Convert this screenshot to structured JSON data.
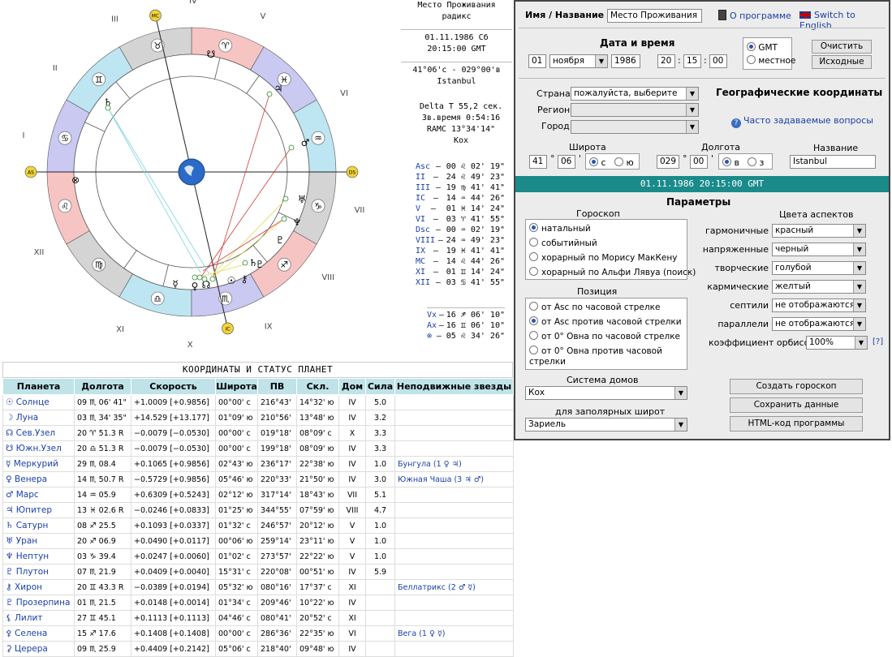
{
  "chart_header": {
    "title1": "Место Проживания",
    "title2": "радикс",
    "date": "01.11.1986 Сб",
    "time": "20:15:00 GMT",
    "coords": "41°06'c - 029°00'в",
    "city": "Istanbul"
  },
  "delta": {
    "deltat": "Delta T  55,2 сек.",
    "sidereal": "Зв.время 0:54:16",
    "ramc": "RAMC 13°34'14\"",
    "system": "Кох"
  },
  "cusps": [
    {
      "label": "Asc",
      "value": "00 ♌ 02' 19\""
    },
    {
      "label": "II",
      "value": "24 ♌ 49' 23\""
    },
    {
      "label": "III",
      "value": "19 ♍ 41' 41\""
    },
    {
      "label": "IC",
      "value": "14 ♒ 44' 26\""
    },
    {
      "label": "V",
      "value": "01 ♓ 14' 24\""
    },
    {
      "label": "VI",
      "value": "03 ♈ 41' 55\""
    },
    {
      "label": "Dsc",
      "value": "00 ♒ 02' 19\""
    },
    {
      "label": "VIII",
      "value": "24 ♒ 49' 23\""
    },
    {
      "label": "IX",
      "value": "19 ♓ 41' 41\""
    },
    {
      "label": "MC",
      "value": "14 ♌ 44' 26\""
    },
    {
      "label": "XI",
      "value": "01 ♊ 14' 24\""
    },
    {
      "label": "XII",
      "value": "03 ♋ 41' 55\""
    }
  ],
  "extra_points": [
    {
      "label": "Vx",
      "value": "16 ♐ 06' 10\""
    },
    {
      "label": "Ax",
      "value": "16 ♊ 06' 10\""
    },
    {
      "label": "⊗",
      "value": "05 ♌ 34' 26\""
    }
  ],
  "wheel": {
    "house_numerals": [
      "I",
      "II",
      "III",
      "IV",
      "V",
      "VI",
      "VII",
      "VIII",
      "IX",
      "X",
      "XI",
      "XII"
    ],
    "axis_labels": {
      "asc": "AS",
      "dsc": "DS",
      "mc": "MC",
      "ic": "IC"
    }
  },
  "planets_table": {
    "title": "КООРДИНАТЫ И СТАТУС ПЛАНЕТ",
    "headers": [
      "Планета",
      "Долгота",
      "Скорость",
      "Широта",
      "ПВ",
      "Скл.",
      "Дом",
      "Сила",
      "Неподвижные звезды"
    ],
    "rows": [
      [
        "☉ Солнце",
        "09 ♏ 06' 41\"",
        "+1.0009  [+0.9856]",
        "00°00' с",
        "216°43'",
        "14°32' ю",
        "IV",
        "5.0",
        ""
      ],
      [
        "☽ Луна",
        "03 ♏ 34' 35\"",
        "+14.529  [+13.177]",
        "01°09' ю",
        "210°56'",
        "13°48' ю",
        "IV",
        "3.2",
        ""
      ],
      [
        "☊ Сев.Узел",
        "20 ♈ 51.3  R",
        "−0.0079  [−0.0530]",
        "00°00' с",
        "019°18'",
        "08°09' с",
        "X",
        "3.3",
        ""
      ],
      [
        "☋ Южн.Узел",
        "20 ♎ 51.3  R",
        "−0.0079  [−0.0530]",
        "00°00' с",
        "199°18'",
        "08°09' ю",
        "IV",
        "3.3",
        ""
      ],
      [
        "☿ Меркурий",
        "29 ♏ 08.4",
        "+0.1065  [+0.9856]",
        "02°43' ю",
        "236°17'",
        "22°38' ю",
        "IV",
        "1.0",
        "Бунгула (1 ♀ ♃)"
      ],
      [
        "♀ Венера",
        "14 ♏ 50.7  R",
        "−0.5729  [+0.9856]",
        "05°46' ю",
        "220°33'",
        "21°50' ю",
        "IV",
        "3.0",
        "Южная Чаша (3 ♃ ♂)"
      ],
      [
        "♂ Марс",
        "14 ♒ 05.9",
        "+0.6309  [+0.5243]",
        "02°12' ю",
        "317°14'",
        "18°43' ю",
        "VII",
        "5.1",
        ""
      ],
      [
        "♃ Юпитер",
        "13 ♓ 02.6  R",
        "−0.0246  [+0.0833]",
        "01°25' ю",
        "344°55'",
        "07°59' ю",
        "VIII",
        "4.7",
        ""
      ],
      [
        "♄ Сатурн",
        "08 ♐ 25.5",
        "+0.1093  [+0.0337]",
        "01°32' с",
        "246°57'",
        "20°12' ю",
        "V",
        "1.0",
        ""
      ],
      [
        "♅ Уран",
        "20 ♐ 06.9",
        "+0.0490  [+0.0117]",
        "00°06' ю",
        "259°14'",
        "23°11' ю",
        "V",
        "1.0",
        ""
      ],
      [
        "♆ Нептун",
        "03 ♑ 39.4",
        "+0.0247  [+0.0060]",
        "01°02' с",
        "273°57'",
        "22°22' ю",
        "V",
        "1.0",
        ""
      ],
      [
        "♇ Плутон",
        "07 ♏ 21.9",
        "+0.0409  [+0.0040]",
        "15°31' с",
        "220°08'",
        "00°51' ю",
        "IV",
        "5.9",
        ""
      ],
      [
        "⚷ Хирон",
        "20 ♊ 43.3  R",
        "−0.0389  [+0.0194]",
        "05°32' ю",
        "080°16'",
        "17°37' с",
        "XI",
        "",
        "Беллатрикс (2 ♂ ☿)"
      ],
      [
        "♇ Прозерпина",
        "01 ♏ 21.5",
        "+0.0148  [+0.0014]",
        "01°34' с",
        "209°46'",
        "10°22' ю",
        "IV",
        "",
        ""
      ],
      [
        "⚸ Лилит",
        "27 ♊ 45.1",
        "+0.1113  [+0.1113]",
        "04°46' с",
        "080°41'",
        "20°52' с",
        "XI",
        "",
        ""
      ],
      [
        "⚴ Селена",
        "15 ♐ 17.6",
        "+0.1408  [+0.1408]",
        "00°00' с",
        "286°36'",
        "22°35' ю",
        "VI",
        "",
        "Вега (1 ♀ ☿)"
      ],
      [
        "⚳ Церера",
        "09 ♏ 25.9",
        "+0.4409  [+0.2142]",
        "05°06' с",
        "218°40'",
        "09°48' ю",
        "IV",
        "",
        ""
      ]
    ]
  },
  "form": {
    "name_label": "Имя / Название",
    "name_value": "Место Проживания",
    "about_link": "О программе",
    "english_link": "Switch to English",
    "datetime_title": "Дата и время",
    "day": "01",
    "month": "ноября",
    "year": "1986",
    "hour": "20",
    "minute": "15",
    "second": "00",
    "gmt_label": "GMT",
    "local_label": "местное",
    "clear_button": "Очистить",
    "initial_button": "Исходные",
    "country_label": "Страна",
    "country_value": "пожалуйста, выберите",
    "region_label": "Регион",
    "city_label": "Город",
    "geo_title": "Географические координаты",
    "faq_link": "Часто задаваемые вопросы",
    "lat_label": "Широта",
    "lat_deg": "41",
    "lat_min": "06",
    "lat_n": "с",
    "lat_s": "ю",
    "lon_label": "Долгота",
    "lon_deg": "029",
    "lon_min": "00",
    "lon_e": "в",
    "lon_w": "з",
    "place_label": "Название",
    "place_value": "Istanbul",
    "banner": "01.11.1986   20:15:00 GMT",
    "params_title": "Параметры",
    "horoscope_title": "Гороскоп",
    "horoscope_options": [
      "натальный",
      "событийный",
      "хорарный по Морису МакКену",
      "хорарный по Альфи Лявуа (поиск)"
    ],
    "position_title": "Позиция",
    "position_options": [
      "от Asc по часовой стрелке",
      "от Asc против часовой стрелки",
      "от 0° Овна по часовой стрелке",
      "от 0° Овна против часовой"
    ],
    "position_option4_line2": "стрелки",
    "house_system_label": "Система домов",
    "house_system_value": "Кох",
    "polar_label": "для заполярных широт",
    "polar_value": "Зариель",
    "aspect_colors_title": "Цвета аспектов",
    "aspect_rows": [
      {
        "label": "гармоничные",
        "value": "красный"
      },
      {
        "label": "напряженные",
        "value": "черный"
      },
      {
        "label": "творческие",
        "value": "голубой"
      },
      {
        "label": "кармические",
        "value": "желтый"
      },
      {
        "label": "септили",
        "value": "не отображаются"
      },
      {
        "label": "параллели",
        "value": "не отображаются"
      }
    ],
    "orb_label": "коэффициент орбисов",
    "orb_value": "100%",
    "orb_help": "[?]",
    "create_button": "Создать гороскоп",
    "save_button": "Сохранить данные",
    "html_button": "HTML-код программы"
  },
  "colors": {
    "teal": "#1a8a8a",
    "header_bg": "#bfe3e8",
    "link": "#1a3fa8",
    "red_aspect": "#d23a3a",
    "yellow_aspect": "#e0d84a",
    "blue_line": "#7fd3e0"
  }
}
